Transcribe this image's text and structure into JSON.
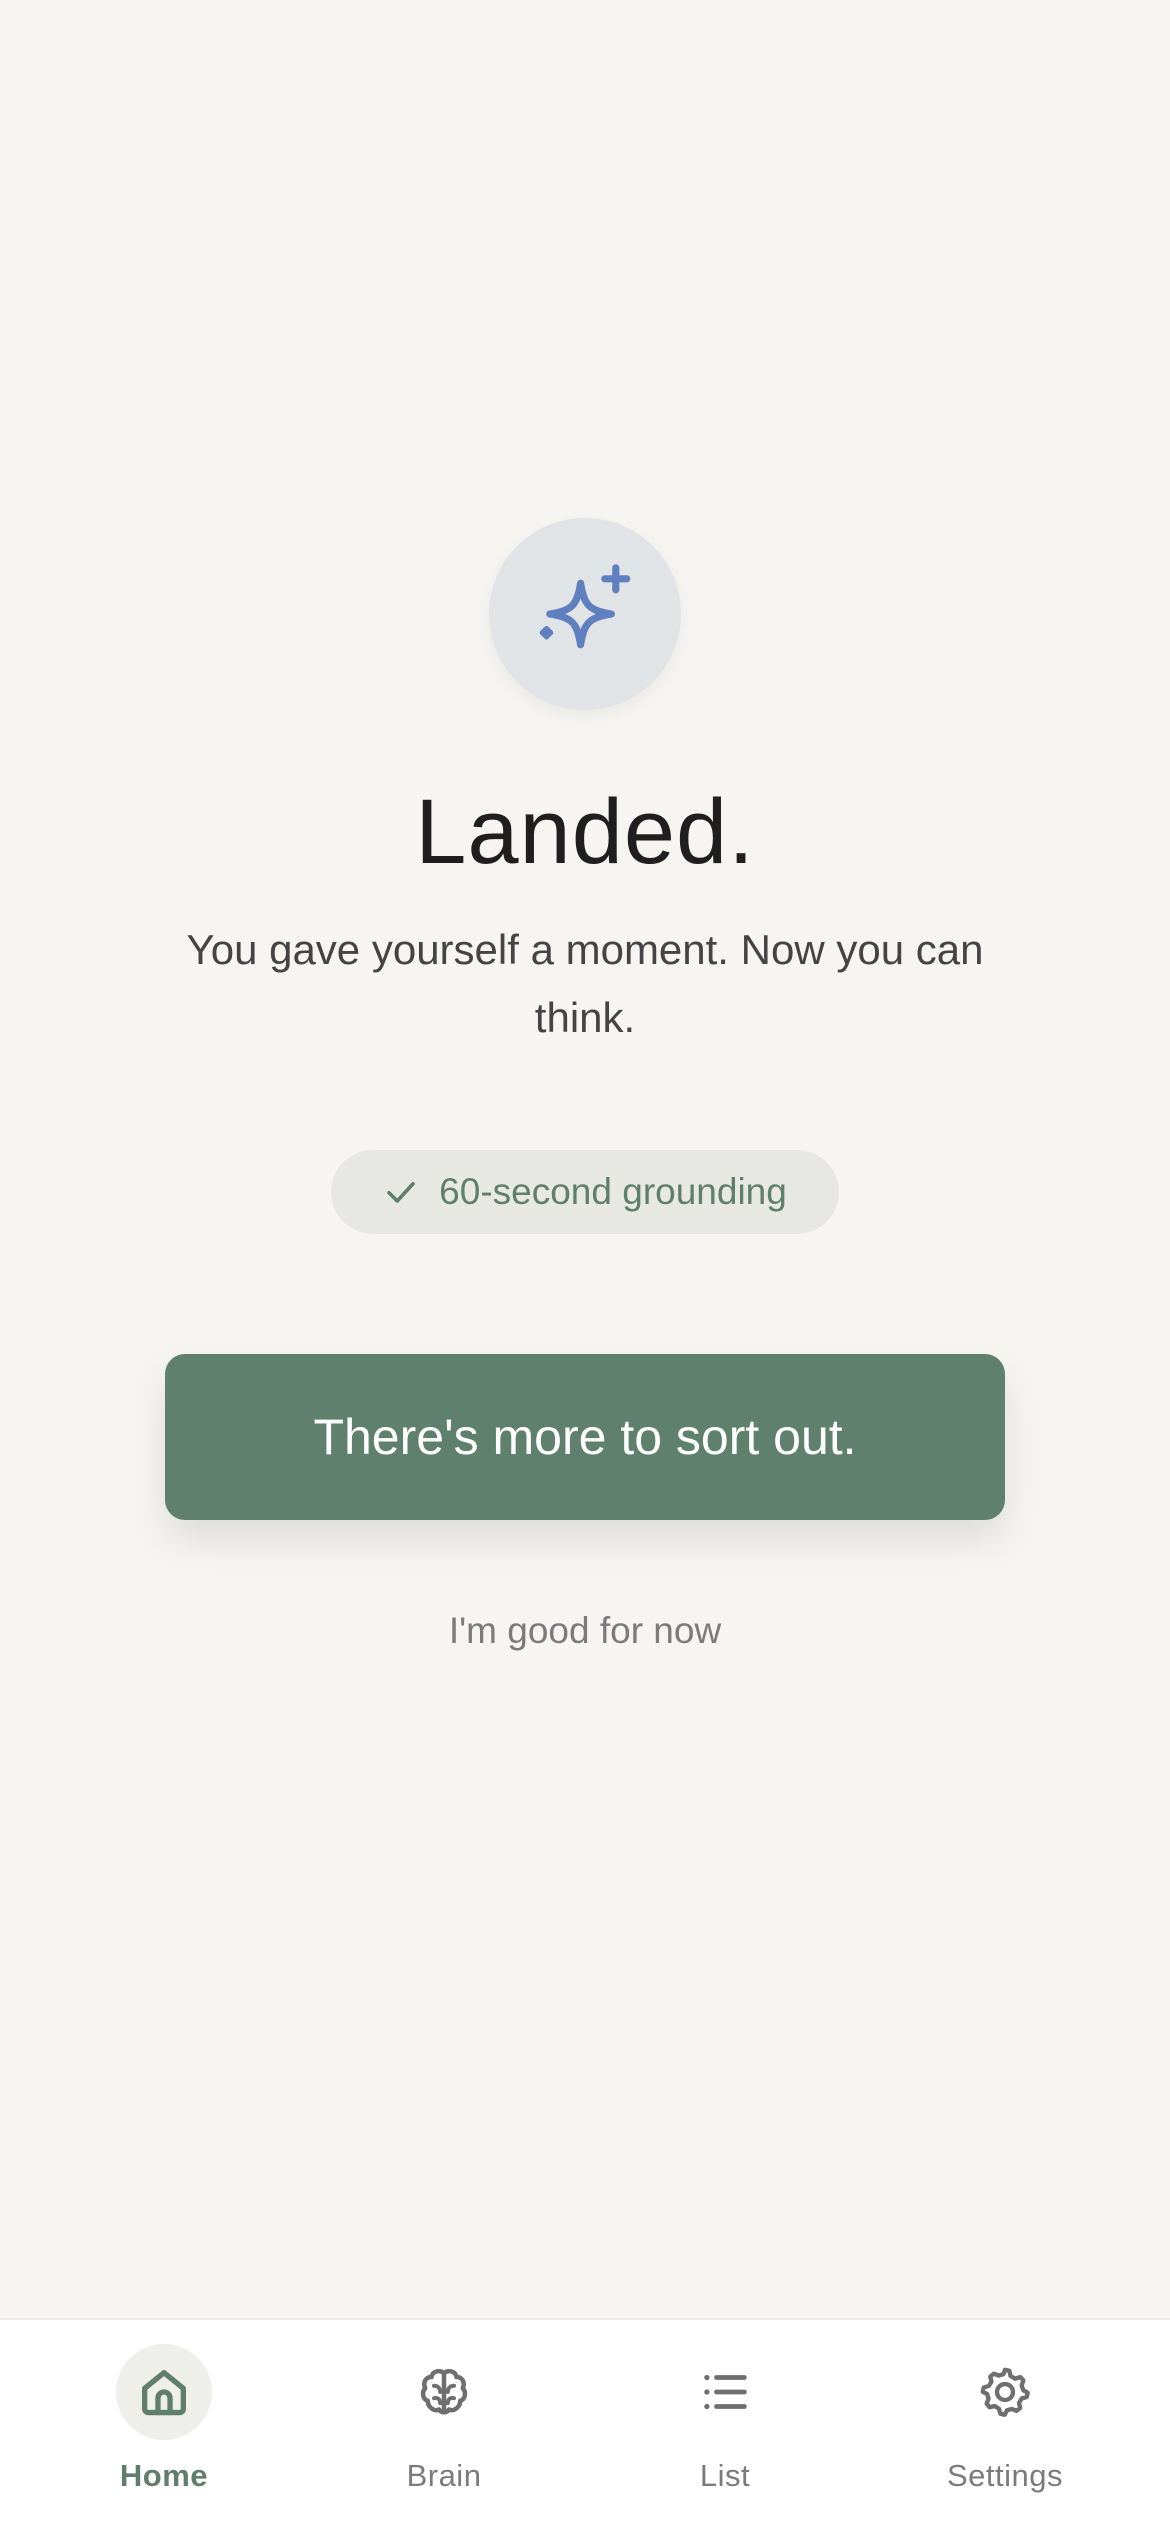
{
  "main": {
    "title": "Landed.",
    "subtitle": "You gave yourself a moment. Now you can think.",
    "badge_icon": "sparkle-icon",
    "pill": {
      "icon": "check-icon",
      "label": "60-second grounding"
    },
    "primary_button_label": "There's more to sort out.",
    "secondary_link_label": "I'm good for now"
  },
  "tabbar": {
    "items": [
      {
        "label": "Home",
        "icon": "home-icon",
        "active": true
      },
      {
        "label": "Brain",
        "icon": "brain-icon",
        "active": false
      },
      {
        "label": "List",
        "icon": "list-icon",
        "active": false
      },
      {
        "label": "Settings",
        "icon": "gear-icon",
        "active": false
      }
    ]
  },
  "colors": {
    "background": "#f6f5f2",
    "accent": "#5f806c",
    "badge_icon": "#5f7fbf",
    "text": "#1f1f1f",
    "muted": "#7b7b7b"
  }
}
